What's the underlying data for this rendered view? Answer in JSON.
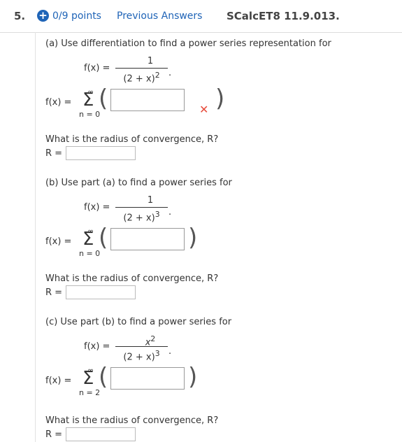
{
  "header": {
    "question_number": "5.",
    "points": "0/9 points",
    "previous_answers": "Previous Answers",
    "assignment_code": "SCalcET8 11.9.013."
  },
  "part_a": {
    "prompt": "(a) Use differentiation to find a power series representation for",
    "func_lhs": "f(x) =",
    "numerator": "1",
    "denominator": "(2 + x)",
    "exponent": "2",
    "sum_lhs": "f(x) =",
    "sum_upper": "∞",
    "sum_lower": "n = 0",
    "radius_question": "What is the radius of convergence, R?",
    "radius_label": "R ="
  },
  "part_b": {
    "prompt": "(b) Use part (a) to find a power series for",
    "func_lhs": "f(x) =",
    "numerator": "1",
    "denominator": "(2 + x)",
    "exponent": "3",
    "sum_lhs": "f(x) =",
    "sum_upper": "∞",
    "sum_lower": "n = 0",
    "radius_question": "What is the radius of convergence, R?",
    "radius_label": "R ="
  },
  "part_c": {
    "prompt": "(c) Use part (b) to find a power series for",
    "func_lhs": "f(x) =",
    "numerator": "x",
    "numerator_exp": "2",
    "denominator": "(2 + x)",
    "exponent": "3",
    "sum_lhs": "f(x) =",
    "sum_upper": "∞",
    "sum_lower": "n = 2",
    "radius_question": "What is the radius of convergence, R?",
    "radius_label": "R ="
  },
  "icons": {
    "points_badge": "plus-circle-icon",
    "incorrect": "x-mark-icon"
  }
}
